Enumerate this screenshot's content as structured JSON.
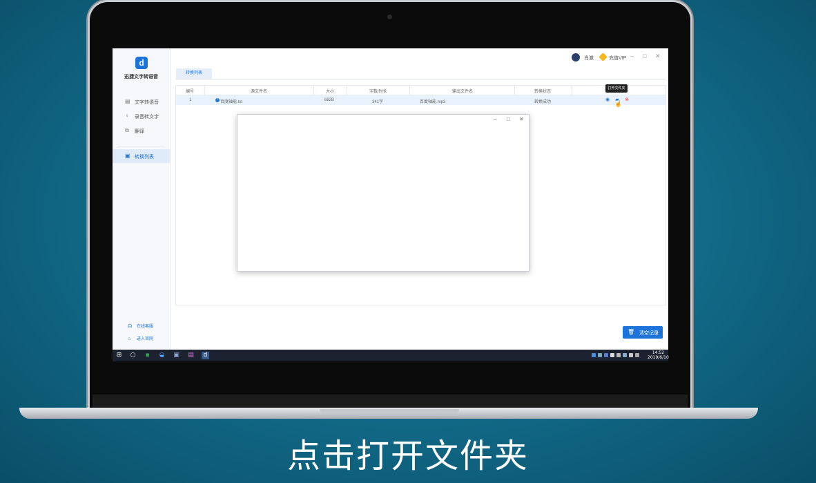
{
  "app": {
    "name": "迅捷文字转语音"
  },
  "sidebar": {
    "items": [
      {
        "label": "文字转语音",
        "icon": "text-to-speech-icon"
      },
      {
        "label": "录音转文字",
        "icon": "microphone-icon"
      },
      {
        "label": "翻译",
        "icon": "translate-icon"
      },
      {
        "label": "转换列表",
        "icon": "conversion-list-icon"
      }
    ],
    "footer": [
      {
        "label": "在线客服",
        "icon": "customer-service-icon"
      },
      {
        "label": "进入官网",
        "icon": "website-icon"
      }
    ]
  },
  "topbar": {
    "user": "肖澈",
    "vip": "充值VIP"
  },
  "tabs": [
    {
      "label": "转换列表"
    }
  ],
  "table": {
    "headers": [
      "编号",
      "源文件名",
      "大小",
      "字数/时长",
      "输出文件名",
      "转换状态",
      ""
    ],
    "rows": [
      {
        "id": "1",
        "source": "百度轴能.txt",
        "size": "682B",
        "length": "341字",
        "output": "百度轴能.mp3",
        "status": "转换成功"
      }
    ],
    "tooltip": "打开文件夹"
  },
  "clear_button": "清空记录",
  "taskbar": {
    "time": "14:52",
    "date": "2019/6/10"
  },
  "caption": "点击打开文件夹",
  "colors": {
    "accent": "#1c73d9",
    "background": "#126e8c"
  }
}
